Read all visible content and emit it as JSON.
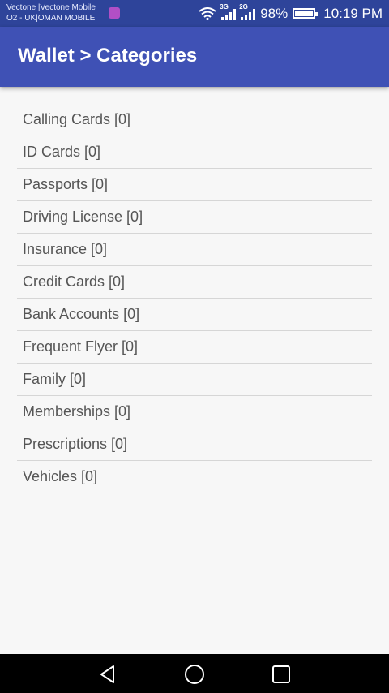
{
  "status_bar": {
    "carrier_line1": "Vectone |Vectone Mobile",
    "carrier_line2": "O2 - UK|OMAN MOBILE",
    "sim1_network": "3G",
    "sim2_network": "2G",
    "battery_percent": "98%",
    "battery_level": 0.98,
    "time": "10:19 PM"
  },
  "app_bar": {
    "title": "Wallet > Categories"
  },
  "categories": [
    {
      "label": "Calling Cards [0]"
    },
    {
      "label": "ID Cards [0]"
    },
    {
      "label": "Passports [0]"
    },
    {
      "label": "Driving License [0]"
    },
    {
      "label": "Insurance [0]"
    },
    {
      "label": "Credit Cards [0]"
    },
    {
      "label": "Bank Accounts [0]"
    },
    {
      "label": "Frequent Flyer [0]"
    },
    {
      "label": "Family [0]"
    },
    {
      "label": "Memberships [0]"
    },
    {
      "label": "Prescriptions [0]"
    },
    {
      "label": "Vehicles [0]"
    }
  ],
  "nav_bar": {
    "icons": [
      "back-icon",
      "home-icon",
      "recent-apps-icon"
    ]
  },
  "colors": {
    "status_bar": "#2e449a",
    "app_bar": "#3f51b5",
    "background": "#f7f7f7",
    "item_text": "#555555",
    "divider": "#d6d6d6"
  }
}
